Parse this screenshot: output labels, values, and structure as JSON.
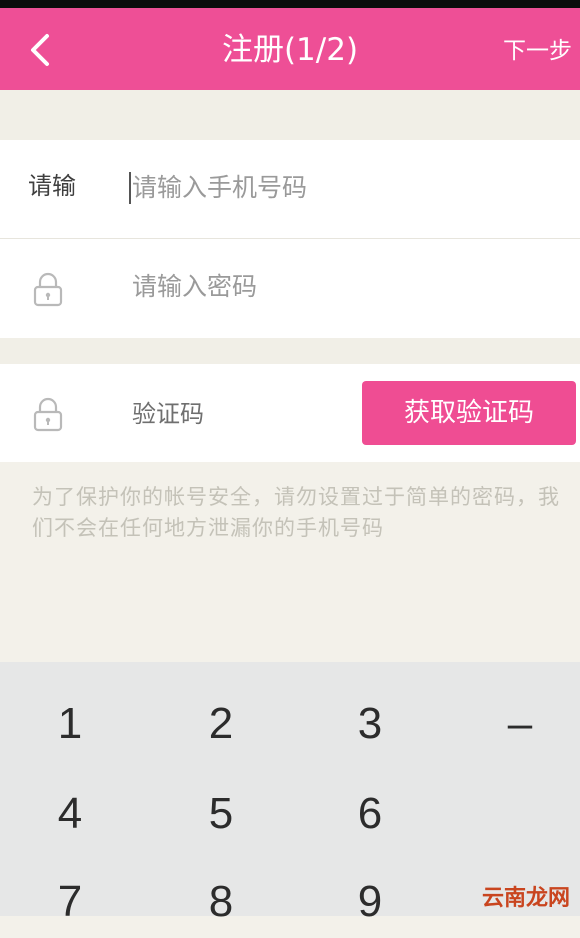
{
  "header": {
    "back_icon": "chevron-left-icon",
    "title": "注册(1/2)",
    "next_label": "下一步"
  },
  "form": {
    "phone": {
      "label": "请输",
      "placeholder": "请输入手机号码",
      "value": ""
    },
    "password": {
      "icon": "lock-icon",
      "placeholder": "请输入密码",
      "value": ""
    },
    "code": {
      "icon": "lock-icon",
      "placeholder": "验证码",
      "value": "",
      "button_label": "获取验证码"
    }
  },
  "hint_text": "为了保护你的帐号安全，请勿设置过于简单的密码，我们不会在任何地方泄漏你的手机号码",
  "keyboard": {
    "keys": [
      "1",
      "2",
      "3",
      "–",
      "4",
      "5",
      "6",
      "7",
      "8",
      "9"
    ]
  },
  "watermark": "云南龙网",
  "colors": {
    "accent": "#ee4f96",
    "background": "#f3f1ea",
    "keyboard": "#e6e7e7"
  }
}
